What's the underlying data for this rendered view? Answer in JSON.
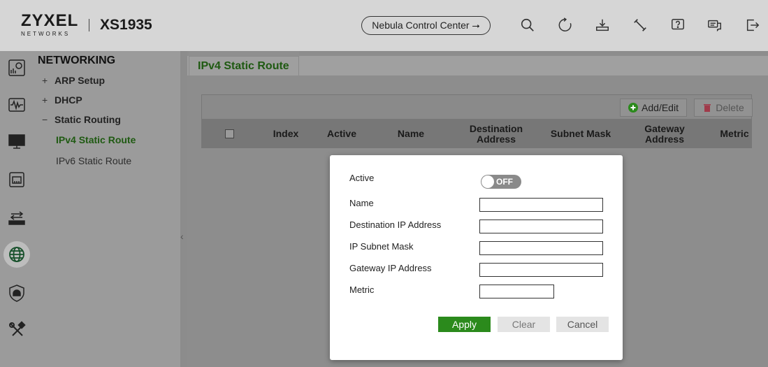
{
  "header": {
    "logo_main": "ZYXEL",
    "logo_sub": "NETWORKS",
    "model": "XS1935",
    "nebula_label": "Nebula Control Center ⭢",
    "icons": [
      "search-icon",
      "refresh-icon",
      "save-icon",
      "tools-icon",
      "help-icon",
      "chat-icon",
      "logout-icon"
    ]
  },
  "rail": {
    "icons": [
      "dashboard-icon",
      "monitor-icon",
      "system-icon",
      "port-icon",
      "switching-icon",
      "networking-icon",
      "security-icon",
      "maintenance-icon"
    ],
    "active": "networking-icon"
  },
  "subnav": {
    "title": "NETWORKING",
    "items": [
      {
        "label": "ARP Setup",
        "marker": "+"
      },
      {
        "label": "DHCP",
        "marker": "+"
      },
      {
        "label": "Static Routing",
        "marker": "−"
      }
    ],
    "leaves": [
      {
        "label": "IPv4 Static Route",
        "active": true
      },
      {
        "label": "IPv6 Static Route",
        "active": false
      }
    ]
  },
  "main": {
    "tab": "IPv4 Static Route",
    "toolbar": {
      "add_edit": "Add/Edit",
      "delete": "Delete"
    },
    "columns": [
      "Index",
      "Active",
      "Name",
      "Destination Address",
      "Subnet Mask",
      "Gateway Address",
      "Metric"
    ]
  },
  "modal": {
    "fields": {
      "active_label": "Active",
      "toggle_text": "OFF",
      "name_label": "Name",
      "dest_ip_label": "Destination IP Address",
      "subnet_label": "IP Subnet Mask",
      "gateway_label": "Gateway IP Address",
      "metric_label": "Metric"
    },
    "values": {
      "name": "",
      "dest_ip": "",
      "subnet": "",
      "gateway": "",
      "metric": ""
    },
    "buttons": {
      "apply": "Apply",
      "clear": "Clear",
      "cancel": "Cancel"
    }
  },
  "colors": {
    "accent_green": "#2b8a1c",
    "nav_active": "#1f5a12"
  }
}
